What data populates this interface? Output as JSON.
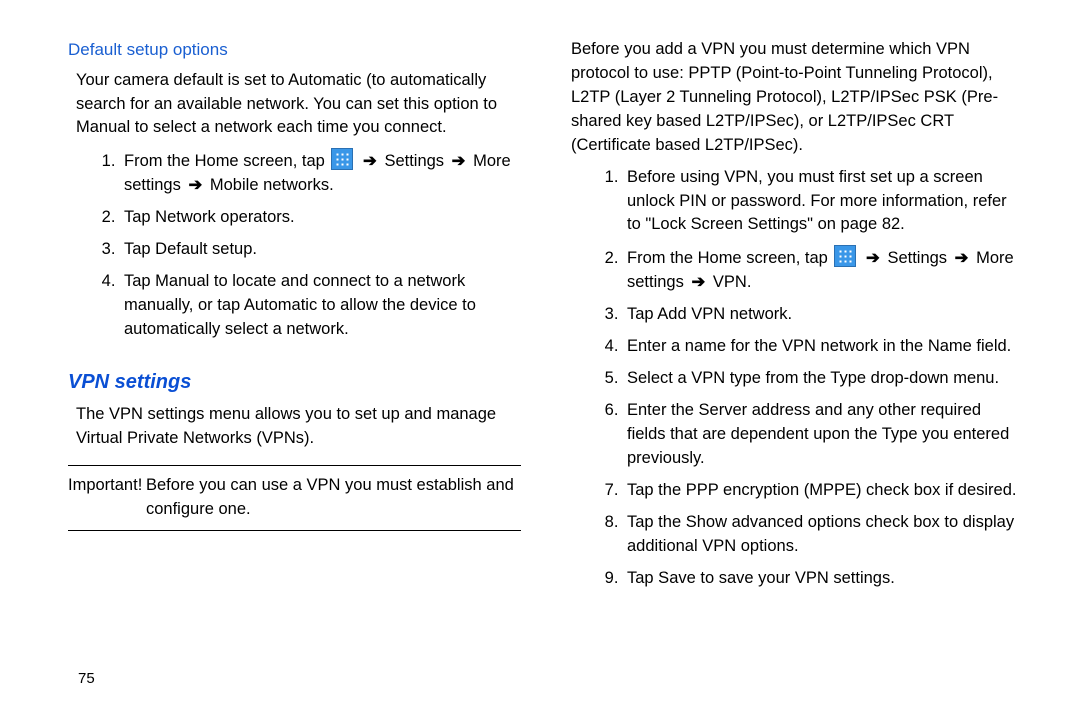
{
  "left": {
    "subhead": "Default setup options",
    "intro": "Your camera default is set to Automatic (to automatically search for an available network. You can set this option to Manual to select a network each time you connect.",
    "steps": {
      "s1_a": "From the Home screen, tap ",
      "s1_b": " Settings",
      "s1_c": " More settings",
      "s1_d": " Mobile networks.",
      "s2": "Tap Network operators.",
      "s3": "Tap Default setup.",
      "s4": "Tap Manual to locate and connect to a network manually, or tap Automatic to allow the device to automatically select a network."
    },
    "vpn_title": "VPN settings",
    "vpn_intro": "The VPN settings menu allows you to set up and manage Virtual Private Networks (VPNs).",
    "important_label": "Important!",
    "important_text": "Before you can use a VPN you must establish and configure one."
  },
  "right": {
    "intro": "Before you add a VPN you must determine which VPN protocol to use: PPTP (Point-to-Point Tunneling Protocol), L2TP (Layer 2 Tunneling Protocol), L2TP/IPSec PSK (Pre-shared key based L2TP/IPSec), or L2TP/IPSec CRT (Certificate based L2TP/IPSec).",
    "steps": {
      "s1_a": "Before using VPN, you must first set up a screen unlock PIN or password. For more information, refer to ",
      "s1_ref": "\"Lock Screen Settings\"",
      "s1_b": " on page 82.",
      "s2_a": "From the Home screen, tap ",
      "s2_b": " Settings",
      "s2_c": " More settings",
      "s2_d": " VPN.",
      "s3": "Tap Add VPN network.",
      "s4": "Enter a name for the VPN network in the Name field.",
      "s5": "Select a VPN type from the Type drop-down menu.",
      "s6": "Enter the Server address and any other required fields that are dependent upon the Type you entered previously.",
      "s7": "Tap the PPP encryption (MPPE) check box if desired.",
      "s8": "Tap the Show advanced options check box to display additional VPN options.",
      "s9": "Tap Save to save your VPN settings."
    }
  },
  "arrow": "➔",
  "page_number": "75"
}
